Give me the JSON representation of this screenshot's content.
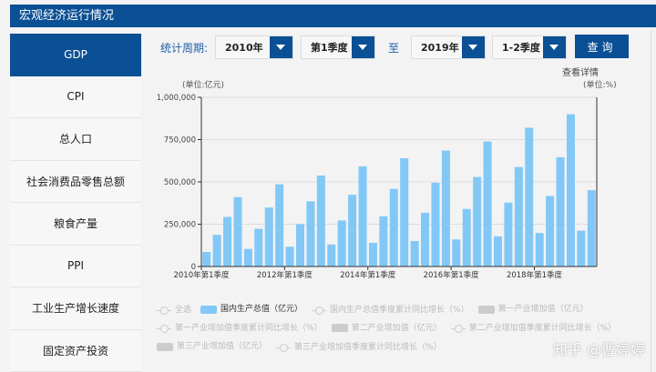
{
  "title": "宏观经济运行情况",
  "sidebar": {
    "items": [
      {
        "label": "GDP",
        "active": true
      },
      {
        "label": "CPI"
      },
      {
        "label": "总人口"
      },
      {
        "label": "社会消费品零售总额"
      },
      {
        "label": "粮食产量"
      },
      {
        "label": "PPI"
      },
      {
        "label": "工业生产增长速度"
      },
      {
        "label": "固定资产投资"
      }
    ]
  },
  "filter": {
    "label": "统计周期:",
    "start_year": "2010年",
    "start_quarter": "第1季度",
    "to": "至",
    "end_year": "2019年",
    "end_quarter": "1-2季度",
    "query": "查询"
  },
  "details_link": "查看详情",
  "unit_left": "(单位:亿元)",
  "unit_right": "(单位:%)",
  "colors": {
    "brand": "#0b4f94",
    "bar": "#82c8f7"
  },
  "legend": [
    {
      "label": "全选",
      "type": "line",
      "active": false
    },
    {
      "label": "国内生产总值（亿元）",
      "type": "bar",
      "active": true
    },
    {
      "label": "国内生产总值季度累计同比增长（%）",
      "type": "line",
      "active": false
    },
    {
      "label": "第一产业增加值（亿元）",
      "type": "bar",
      "active": false
    },
    {
      "label": "第一产业增加值季度累计同比增长（%）",
      "type": "line",
      "active": false
    },
    {
      "label": "第二产业增加值（亿元）",
      "type": "bar",
      "active": false
    },
    {
      "label": "第二产业增加值季度累计同比增长（%）",
      "type": "line",
      "active": false
    },
    {
      "label": "第三产业增加值（亿元）",
      "type": "bar",
      "active": false
    },
    {
      "label": "第三产业增加值季度累计同比增长（%）",
      "type": "line",
      "active": false
    }
  ],
  "watermark": "知乎 @曹婷婷",
  "chart_data": {
    "type": "bar",
    "ylim": [
      0,
      1000000
    ],
    "yticks": [
      "0",
      "250,000",
      "500,000",
      "750,000",
      "1,000,000"
    ],
    "ytick_values": [
      0,
      250000,
      500000,
      750000,
      1000000
    ],
    "xtick_labels": [
      "2010年第1季度",
      "2012年第1季度",
      "2014年第1季度",
      "2016年第1季度",
      "2018年第1季度"
    ],
    "xtick_index": [
      0,
      8,
      16,
      24,
      32
    ],
    "series": [
      {
        "name": "国内生产总值（亿元）",
        "values": [
          86000,
          187000,
          293000,
          410000,
          104000,
          223000,
          349000,
          486000,
          117000,
          250000,
          385000,
          538000,
          130000,
          272000,
          424000,
          592000,
          140000,
          297000,
          459000,
          640000,
          151000,
          318000,
          495000,
          685000,
          160000,
          340000,
          529000,
          739000,
          178000,
          378000,
          588000,
          820000,
          198000,
          417000,
          646000,
          900000,
          212000,
          451000
        ]
      }
    ],
    "grid": true
  }
}
